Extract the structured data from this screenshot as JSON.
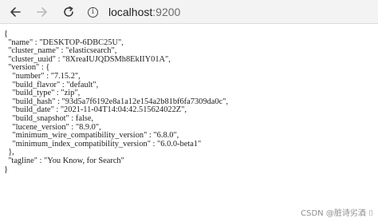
{
  "browser": {
    "address_bar": {
      "host": "localhost",
      "port": ":9200"
    },
    "icons": {
      "back": "arrow-left-icon",
      "forward": "arrow-right-icon",
      "reload": "reload-icon",
      "site_info": "info-icon",
      "site_info_glyph": "i"
    }
  },
  "json_view": {
    "lines": [
      "{",
      "  \"name\" : \"DESKTOP-6DBC25U\",",
      "  \"cluster_name\" : \"elasticsearch\",",
      "  \"cluster_uuid\" : \"8XreaIUJQDSMh8EkIIY01A\",",
      "  \"version\" : {",
      "    \"number\" : \"7.15.2\",",
      "    \"build_flavor\" : \"default\",",
      "    \"build_type\" : \"zip\",",
      "    \"build_hash\" : \"93d5a7f6192e8a1a12e154a2b81bf6fa7309da0c\",",
      "    \"build_date\" : \"2021-11-04T14:04:42.515624022Z\",",
      "    \"build_snapshot\" : false,",
      "    \"lucene_version\" : \"8.9.0\",",
      "    \"minimum_wire_compatibility_version\" : \"6.8.0\",",
      "    \"minimum_index_compatibility_version\" : \"6.0.0-beta1\"",
      "  },",
      "  \"tagline\" : \"You Know, for Search\"",
      "}"
    ]
  },
  "watermark": "CSDN @脏诗劣酒 ⌷",
  "colors": {
    "toolbar_bg": "#f3f3f3",
    "text": "#222222",
    "watermark": "#8e8e8e",
    "disabled_icon": "#b9b9b9"
  }
}
